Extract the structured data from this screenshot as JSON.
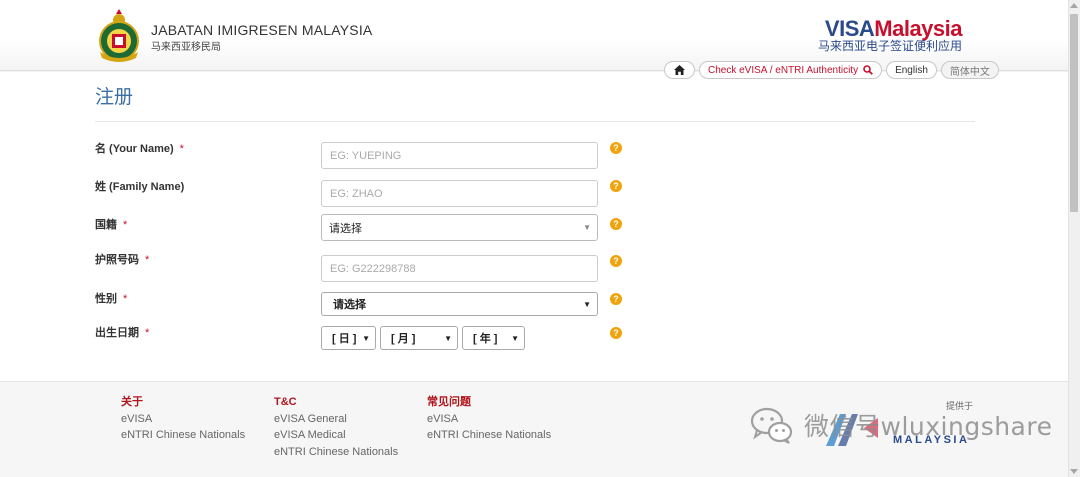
{
  "header": {
    "org_title": "JABATAN IMIGRESEN MALAYSIA",
    "org_subtitle": "马来西亚移民局",
    "brand_part1": "VISA",
    "brand_part2": "Malaysia",
    "brand_subtitle": "马来西亚电子签证便利应用",
    "nav": {
      "home_icon": "home-icon",
      "check_label": "Check eVISA / eNTRI Authenticity",
      "check_icon": "search-icon",
      "lang_english": "English",
      "lang_chinese": "简体中文"
    }
  },
  "page": {
    "title": "注册"
  },
  "form": {
    "given_name": {
      "label": "名 (Your Name)",
      "required": "*",
      "placeholder": "EG: YUEPING"
    },
    "family_name": {
      "label": "姓 (Family Name)",
      "placeholder": "EG: ZHAO"
    },
    "nationality": {
      "label": "国籍",
      "required": "*",
      "selected": "请选择"
    },
    "passport": {
      "label": "护照号码",
      "required": "*",
      "placeholder": "EG: G222298788"
    },
    "gender": {
      "label": "性别",
      "required": "*",
      "selected": "请选择"
    },
    "dob": {
      "label": "出生日期",
      "required": "*",
      "day": "[ 日 ]",
      "month": "[ 月 ]",
      "year": "[ 年 ]"
    },
    "help_glyph": "?"
  },
  "footer": {
    "col1": {
      "heading": "关于",
      "links": [
        "eVISA",
        "eNTRI Chinese Nationals"
      ]
    },
    "col2": {
      "heading": "T&C",
      "links": [
        "eVISA General",
        "eVISA Medical",
        "eNTRI Chinese Nationals"
      ]
    },
    "col3": {
      "heading": "常见问题",
      "links": [
        "eVISA",
        "eNTRI Chinese Nationals"
      ]
    },
    "provided_by": "提供于",
    "vm_text": "MALAYSIA"
  },
  "watermark": {
    "text": "微信号wluxingshare"
  },
  "colors": {
    "accent_blue": "#3b6fa6",
    "brand_red": "#c8102e",
    "help_orange": "#f0a30a",
    "footer_heading": "#b0151b"
  }
}
